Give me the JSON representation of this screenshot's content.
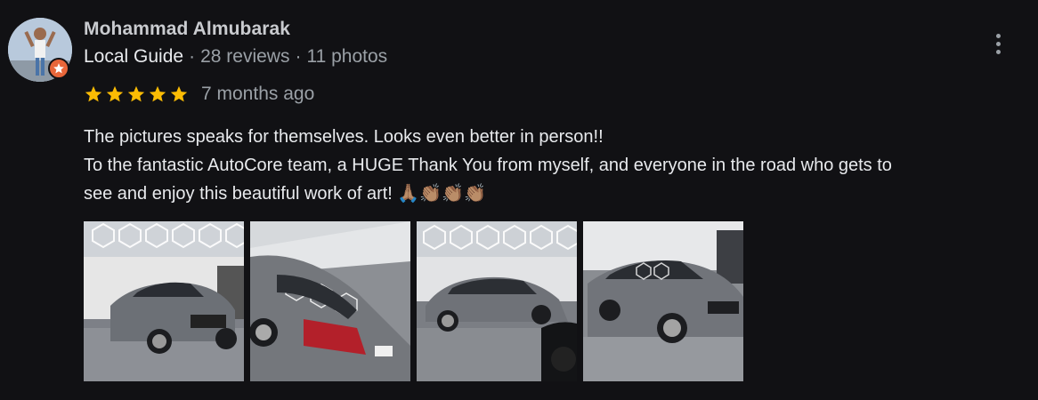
{
  "review": {
    "author": "Mohammad Almubarak",
    "badge": "Local Guide",
    "reviews": "28 reviews",
    "photos_count": "11 photos",
    "separator": "·",
    "rating": 5,
    "rating_max": 5,
    "time": "7 months ago",
    "text_lines": [
      "The pictures speaks for themselves. Looks even better in person!!",
      "To the fantastic AutoCore team, a HUGE Thank You from myself, and everyone in the road who gets to",
      "see and enjoy this beautiful work of art! 🙏🏽👏🏽👏🏽👏🏽"
    ],
    "photos": [
      {
        "name": "review-photo-1"
      },
      {
        "name": "review-photo-2"
      },
      {
        "name": "review-photo-3"
      },
      {
        "name": "review-photo-4"
      }
    ]
  },
  "icons": {
    "more": "more-vert-icon",
    "star": "star-icon",
    "badge": "local-guide-star-icon"
  },
  "colors": {
    "background": "#111114",
    "star": "#fbbc04",
    "badge": "#e8663a",
    "secondary_text": "#9aa0a6",
    "primary_text": "#e8eaed"
  }
}
